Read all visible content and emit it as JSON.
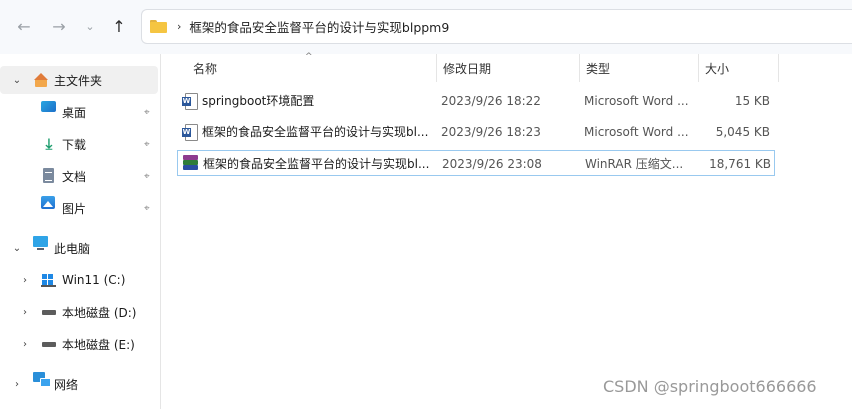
{
  "nav": {
    "back_icon": "←",
    "forward_icon": "→",
    "recent_icon": "⌄",
    "up_icon": "↑"
  },
  "address": {
    "separator": "›",
    "path": "框架的食品安全监督平台的设计与实现blppm9"
  },
  "sidebar": {
    "quick_access": {
      "label": "主文件夹",
      "pin": "📌",
      "items": [
        {
          "label": "桌面"
        },
        {
          "label": "下载"
        },
        {
          "label": "文档"
        },
        {
          "label": "图片"
        }
      ]
    },
    "this_pc": {
      "label": "此电脑",
      "drives": [
        {
          "label": "Win11 (C:)"
        },
        {
          "label": "本地磁盘 (D:)"
        },
        {
          "label": "本地磁盘 (E:)"
        }
      ]
    },
    "network": {
      "label": "网络"
    },
    "chevron_expanded": "⌄",
    "chevron_collapsed": "›"
  },
  "columns": {
    "name": "名称",
    "date": "修改日期",
    "type": "类型",
    "size": "大小",
    "sort_caret": "^"
  },
  "files": [
    {
      "name": "springboot环境配置",
      "date": "2023/9/26 18:22",
      "type": "Microsoft Word ...",
      "size": "15 KB",
      "icon": "word-document-icon"
    },
    {
      "name": "框架的食品安全监督平台的设计与实现bl...",
      "date": "2023/9/26 18:23",
      "type": "Microsoft Word ...",
      "size": "5,045 KB",
      "icon": "word-document-icon"
    },
    {
      "name": "框架的食品安全监督平台的设计与实现bl...",
      "date": "2023/9/26 23:08",
      "type": "WinRAR 压缩文...",
      "size": "18,761 KB",
      "icon": "winrar-archive-icon"
    }
  ],
  "watermark": "CSDN @springboot666666",
  "colors": {
    "accent": "#99c9ef",
    "folder": "#f5c542",
    "word": "#2b579a"
  }
}
